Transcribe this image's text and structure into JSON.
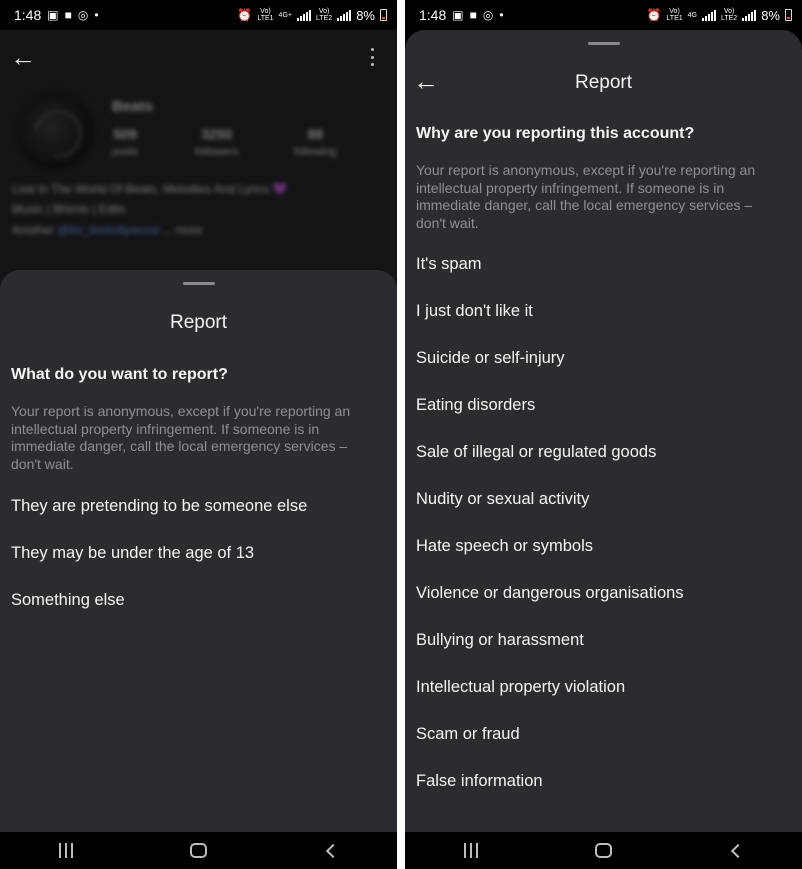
{
  "status_bar": {
    "time": "1:48",
    "battery": "8%",
    "left_icons": [
      "image-icon",
      "chat-icon",
      "sync-icon",
      "dot-icon"
    ],
    "right_icons": [
      "alarm-icon",
      "volte-lte1-icon",
      "signal-icon",
      "volte-lte2-icon",
      "signal-icon",
      "battery-icon"
    ],
    "net_left": "4G+",
    "net_right": "4G"
  },
  "left_screen": {
    "background_profile": {
      "username": "Beats",
      "stats": [
        {
          "value": "509",
          "label": "posts"
        },
        {
          "value": "3250",
          "label": "followers"
        },
        {
          "value": "88",
          "label": "following"
        }
      ],
      "bio_line1": "Lost In The World Of Beats, Melodies And Lyrics 💜",
      "bio_line2": "Music | Bhimis | Edits",
      "bio_prefix": "Another",
      "bio_link": "@thi_thebollywood",
      "bio_more": "... more"
    },
    "sheet": {
      "title": "Report",
      "question": "What do you want to report?",
      "note": "Your report is anonymous, except if you're reporting an intellectual property infringement. If someone is in immediate danger, call the local emergency services – don't wait.",
      "options": [
        "They are pretending to be someone else",
        "They may be under the age of 13",
        "Something else"
      ]
    }
  },
  "right_screen": {
    "sheet": {
      "title": "Report",
      "question": "Why are you reporting this account?",
      "note": "Your report is anonymous, except if you're reporting an intellectual property infringement. If someone is in immediate danger, call the local emergency services – don't wait.",
      "options": [
        "It's spam",
        "I just don't like it",
        "Suicide or self-injury",
        "Eating disorders",
        "Sale of illegal or regulated goods",
        "Nudity or sexual activity",
        "Hate speech or symbols",
        "Violence or dangerous organisations",
        "Bullying or harassment",
        "Intellectual property violation",
        "Scam or fraud",
        "False information"
      ]
    }
  },
  "nav_bar": {
    "buttons": [
      "recents-icon",
      "home-icon",
      "back-icon"
    ]
  },
  "colors": {
    "sheet_bg": "#2b2c30",
    "text_primary": "#f5f5f5",
    "text_secondary": "#8f9096"
  }
}
